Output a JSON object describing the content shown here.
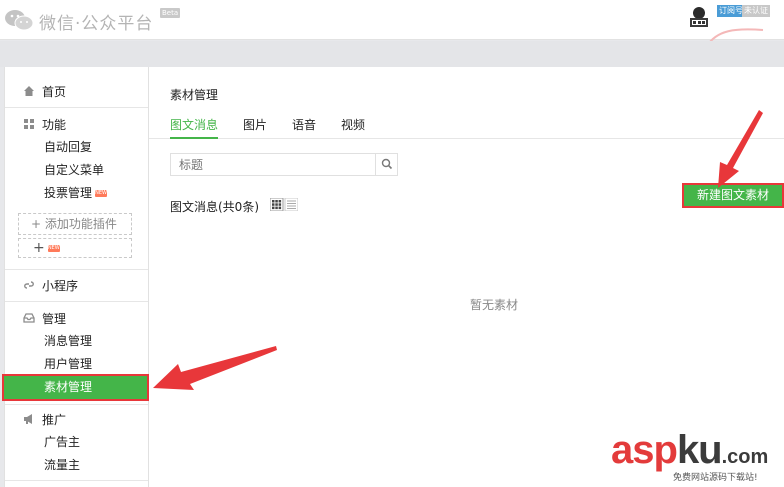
{
  "header": {
    "brand": "微信·公众平台",
    "beta": "Beta",
    "account_type_badge": "订阅号",
    "account_status_badge": "未认证"
  },
  "sidebar": {
    "home": "首页",
    "function": {
      "label": "功能",
      "items": [
        "自动回复",
        "自定义菜单",
        "投票管理"
      ],
      "new_tag": "NEW",
      "add_plugin": "+ 添加功能插件",
      "plus": "+"
    },
    "mini_program": "小程序",
    "manage": {
      "label": "管理",
      "items": [
        "消息管理",
        "用户管理"
      ],
      "active": "素材管理"
    },
    "promote": {
      "label": "推广",
      "items": [
        "广告主",
        "流量主"
      ]
    }
  },
  "main": {
    "title": "素材管理",
    "tabs": [
      "图文消息",
      "图片",
      "语音",
      "视频"
    ],
    "active_tab": "图文消息",
    "search_placeholder": "标题",
    "count_label": "图文消息(共0条)",
    "new_button": "新建图文素材",
    "empty_text": "暂无素材"
  },
  "watermark": {
    "asp": "asp",
    "ku": "ku",
    "com": ".com",
    "sub": "免费网站源码下载站!"
  },
  "colors": {
    "accent_green": "#44b549",
    "highlight_red": "#e8373a"
  }
}
